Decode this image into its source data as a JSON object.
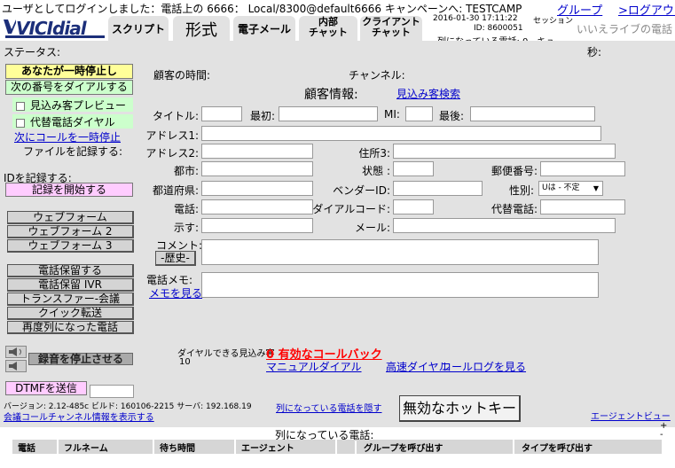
{
  "header": {
    "login_info": "ユーザとしてログインしました：電話上の 6666：  Local/8300@default6666  キャンペーンへ: TESTCAMP",
    "groups_link": "グループ",
    "logout_link": ">ログアウト",
    "datetime": "2016-01-30 17:11:22",
    "session_label": "セッション",
    "id_label": "ID: 8600051",
    "queue_info": "列になっている電話: 0 - キュ",
    "no_live_call": "いいえライブの電話"
  },
  "logo": {
    "text": "VICIdial"
  },
  "tabs": [
    "スクリプト",
    "形式",
    "電子メール",
    "内部\nチャット",
    "クライアント\nチャット"
  ],
  "status": {
    "label": "ステータス:",
    "seconds": "秒:"
  },
  "left_panel": {
    "pause_button": "あなたが一時停止し",
    "dial_next": "次の番号をダイアルする",
    "preview_label": "見込み客プレビュー",
    "alt_dial_label": "代替電話ダイヤル",
    "pause_next_call": "次にコールを一時停止",
    "file_record": "ファイルを記録する:",
    "record_id": "IDを記録する:",
    "start_record": "記録を開始する",
    "webform1": "ウェブフォーム",
    "webform2": "ウェブフォーム 2",
    "webform3": "ウェブフォーム 3",
    "hold_call": "電話保留する",
    "hold_ivr": "電話保留 IVR",
    "transfer_conf": "トランスファー-会議",
    "quick_transfer": "クイック転送",
    "requeue": "再度列になった電話",
    "stop_recording": "録音を停止させる",
    "dtmf_send": "DTMFを送信",
    "version": "バージョン: 2.12-485c  ビルド: 160106-2215   サーバ: 192.168.19",
    "conf_channel_link": "会議コールチャンネル情報を表示する"
  },
  "form": {
    "customer_time": "顧客の時間:",
    "channel": "チャンネル:",
    "customer_info": "顧客情報:",
    "lead_search": "見込み客検索",
    "title": "タイトル:",
    "first": "最初:",
    "mi": "MI:",
    "last": "最後:",
    "address1": "アドレス1:",
    "address2": "アドレス2:",
    "address3": "住所3:",
    "city": "都市:",
    "state": "状態 :",
    "postal": "郵便番号:",
    "province": "都道府県:",
    "vendor_id": "ベンダーID:",
    "gender": "性別:",
    "gender_value": "Uは - 不定",
    "phone": "電話:",
    "dial_code": "ダイアルコード:",
    "alt_phone": "代替電話:",
    "show": "示す:",
    "email": "メール:",
    "comment": "コメント:",
    "history_button": "-歴史-",
    "call_notes": "電話メモ:",
    "view_notes": "メモを見る"
  },
  "bottom": {
    "dialable_leads_label": "ダイヤルできる見込み客",
    "dialable_leads_count": "10",
    "active_callbacks": "0 有効なコールバック",
    "manual_dial": "マニュアルダイアル",
    "fast_dial": "高速ダイヤル",
    "call_log": "コールログを見る",
    "hide_queue": "列になっている電話を隠す",
    "invalid_hotkey": "無効なホットキー",
    "agent_view": "エージェントビュー",
    "queue_title": "列になっている電話:",
    "queue_columns": [
      "電話",
      "フルネーム",
      "待ち時間",
      "エージェント",
      "グループを呼び出す",
      "タイプを呼び出す"
    ]
  },
  "colors": {
    "pause_yellow": "#ffff99",
    "dial_green": "#ccffcc",
    "record_pink": "#ffccff",
    "callback_red": "#ff0000",
    "logo_blue": "#1c2f7a"
  }
}
